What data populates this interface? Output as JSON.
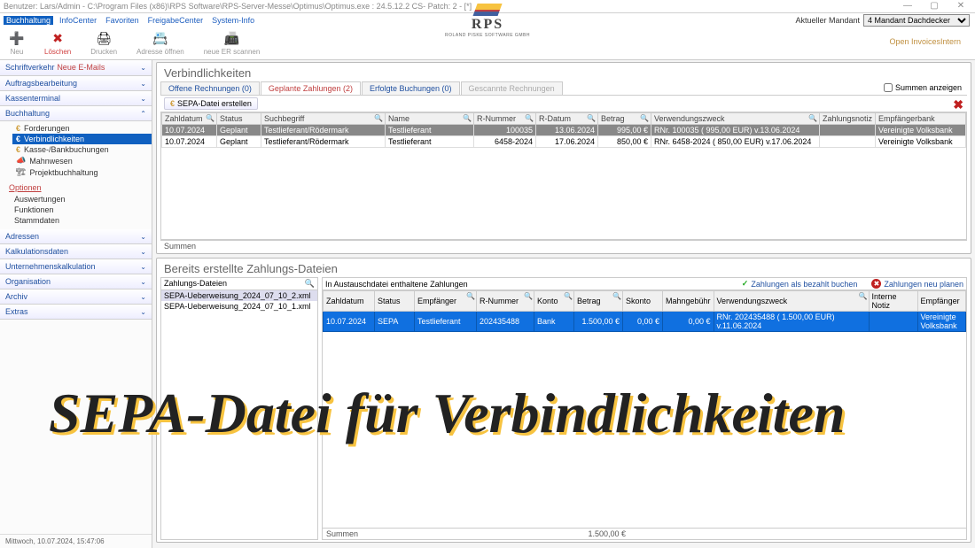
{
  "title": "Benutzer: Lars/Admin - C:\\Program Files (x86)\\RPS Software\\RPS-Server-Messe\\Optimus\\Optimus.exe : 24.5.12.2 CS- Patch: 2 - [*]",
  "menu": [
    "Buchhaltung",
    "InfoCenter",
    "Favoriten",
    "FreigabeCenter",
    "System-Info"
  ],
  "mandant_label": "Aktueller Mandant",
  "mandant_value": "4 Mandant Dachdecker",
  "logo": {
    "name": "RPS",
    "sub": "ROLAND PISKE\nSOFTWARE GMBH"
  },
  "toolbar": [
    {
      "key": "neu",
      "label": "Neu",
      "icon": "➕"
    },
    {
      "key": "loeschen",
      "label": "Löschen",
      "icon": "✖"
    },
    {
      "key": "drucken",
      "label": "Drucken",
      "icon": "🖨"
    },
    {
      "key": "adresse",
      "label": "Adresse öffnen",
      "icon": "📇"
    },
    {
      "key": "scan",
      "label": "neue ER scannen",
      "icon": "📠"
    }
  ],
  "open_invoices_link": "Open InvoicesIntern",
  "sidebar_sections": [
    {
      "label": "Schriftverkehr",
      "extra": "Neue E-Mails",
      "warn": true
    },
    {
      "label": "Auftragsbearbeitung"
    },
    {
      "label": "Kassenterminal"
    },
    {
      "label": "Buchhaltung",
      "expanded": true
    },
    {
      "label": "Adressen"
    },
    {
      "label": "Kalkulationsdaten"
    },
    {
      "label": "Unternehmenskalkulation"
    },
    {
      "label": "Organisation"
    },
    {
      "label": "Archiv"
    },
    {
      "label": "Extras"
    }
  ],
  "accounting_tree": [
    {
      "label": "Forderungen",
      "icon": "€"
    },
    {
      "label": "Verbindlichkeiten",
      "icon": "€",
      "sel": true
    },
    {
      "label": "Kasse-/Bankbuchungen",
      "icon": "€"
    },
    {
      "label": "Mahnwesen",
      "icon": "📣"
    },
    {
      "label": "Projektbuchhaltung",
      "icon": "🏗"
    }
  ],
  "options_header": "Optionen",
  "options": [
    "Auswertungen",
    "Funktionen",
    "Stammdaten"
  ],
  "status_time": "Mittwoch, 10.07.2024, 15:47:06",
  "panel1_title": "Verbindlichkeiten",
  "tabs": [
    {
      "label": "Offene Rechnungen (0)"
    },
    {
      "label": "Geplante Zahlungen (2)",
      "active": true
    },
    {
      "label": "Erfolgte Buchungen (0)"
    },
    {
      "label": "Gescannte Rechnungen",
      "disabled": true
    }
  ],
  "summen_label": "Summen anzeigen",
  "sepa_button": "SEPA-Datei erstellen",
  "table1_headers": [
    "Zahldatum",
    "Status",
    "Suchbegriff",
    "Name",
    "R-Nummer",
    "R-Datum",
    "Betrag",
    "Verwendungszweck",
    "Zahlungsnotiz",
    "Empfängerbank"
  ],
  "table1_rows": [
    {
      "zd": "10.07.2024",
      "st": "Geplant",
      "sb": "Testlieferant/Rödermark",
      "nm": "Testlieferant",
      "rn": "100035",
      "rd": "13.06.2024",
      "bt": "995,00 €",
      "vz": "RNr. 100035 ( 995,00 EUR) v.13.06.2024",
      "zn": "",
      "eb": "Vereinigte Volksbank",
      "sel": true
    },
    {
      "zd": "10.07.2024",
      "st": "Geplant",
      "sb": "Testlieferant/Rödermark",
      "nm": "Testlieferant",
      "rn": "6458-2024",
      "rd": "17.06.2024",
      "bt": "850,00 €",
      "vz": "RNr. 6458-2024 ( 850,00 EUR) v.17.06.2024",
      "zn": "",
      "eb": "Vereinigte Volksbank"
    }
  ],
  "summen_footer": "Summen",
  "panel2_title": "Bereits erstellte Zahlungs-Dateien",
  "files_header": "Zahlungs-Dateien",
  "files": [
    "SEPA-Ueberweisung_2024_07_10_2.xml",
    "SEPA-Ueberweisung_2024_07_10_1.xml"
  ],
  "paypane_header": "In Austauschdatei enthaltene Zahlungen",
  "paypane_links": {
    "paid": "Zahlungen als bezahlt buchen",
    "replan": "Zahlungen neu planen"
  },
  "table2_headers": [
    "Zahldatum",
    "Status",
    "Empfänger",
    "R-Nummer",
    "Konto",
    "Betrag",
    "Skonto",
    "Mahngebühr",
    "Verwendungszweck",
    "Interne Notiz",
    "Empfänger"
  ],
  "table2_rows": [
    {
      "zd": "10.07.2024",
      "st": "SEPA",
      "em": "Testlieferant",
      "rn": "202435488",
      "kt": "Bank",
      "bt": "1.500,00 €",
      "sk": "0,00 €",
      "mg": "0,00 €",
      "vz": "RNr. 202435488 ( 1.500,00 EUR) v.11.06.2024",
      "in": "",
      "eb": "Vereinigte Volksbank"
    }
  ],
  "table2_sum": {
    "label": "Summen",
    "betrag": "1.500,00 €"
  },
  "overlay": "SEPA-Datei für Verbindlichkeiten"
}
